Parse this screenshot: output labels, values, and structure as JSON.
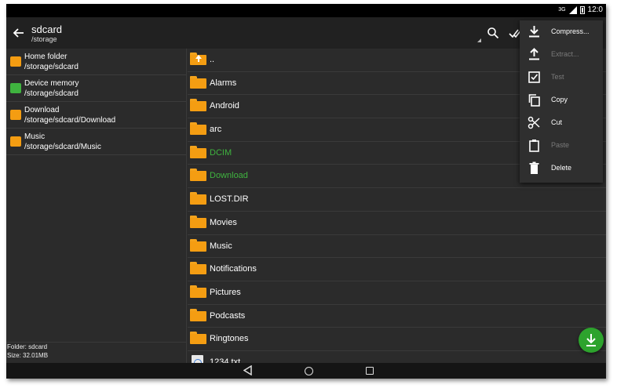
{
  "statusbar": {
    "signal": "3G",
    "time": "12:0"
  },
  "appbar": {
    "title": "sdcard",
    "subtitle": "/storage"
  },
  "bookmarks": [
    {
      "name": "Home folder",
      "path": "/storage/sdcard",
      "icon": "home-icon",
      "color": "#f49d12"
    },
    {
      "name": "Device memory",
      "path": "/storage/sdcard",
      "icon": "android-icon",
      "color": "#3fb33f"
    },
    {
      "name": "Download",
      "path": "/storage/sdcard/Download",
      "icon": "download-folder-icon",
      "color": "#f49d12"
    },
    {
      "name": "Music",
      "path": "/storage/sdcard/Music",
      "icon": "music-folder-icon",
      "color": "#f49d12"
    }
  ],
  "left_footer": {
    "folder": "Folder: sdcard",
    "size": "Size: 32.01MB"
  },
  "files": [
    {
      "name": "..",
      "type": "up"
    },
    {
      "name": "Alarms",
      "type": "folder"
    },
    {
      "name": "Android",
      "type": "folder"
    },
    {
      "name": "arc",
      "type": "folder"
    },
    {
      "name": "DCIM",
      "type": "folder",
      "highlight": true
    },
    {
      "name": "Download",
      "type": "folder",
      "highlight": true
    },
    {
      "name": "LOST.DIR",
      "type": "folder"
    },
    {
      "name": "Movies",
      "type": "folder"
    },
    {
      "name": "Music",
      "type": "folder"
    },
    {
      "name": "Notifications",
      "type": "folder"
    },
    {
      "name": "Pictures",
      "type": "folder"
    },
    {
      "name": "Podcasts",
      "type": "folder"
    },
    {
      "name": "Ringtones",
      "type": "folder"
    },
    {
      "name": "1234.txt",
      "type": "file"
    }
  ],
  "menu": {
    "items": [
      {
        "label": "Compress...",
        "icon": "download-tray-icon",
        "enabled": true
      },
      {
        "label": "Extract...",
        "icon": "upload-tray-icon",
        "enabled": false
      },
      {
        "label": "Test",
        "icon": "checkbox-icon",
        "enabled": false
      },
      {
        "label": "Copy",
        "icon": "copy-icon",
        "enabled": true
      },
      {
        "label": "Cut",
        "icon": "scissors-icon",
        "enabled": true
      },
      {
        "label": "Paste",
        "icon": "clipboard-icon",
        "enabled": false
      },
      {
        "label": "Delete",
        "icon": "trash-icon",
        "enabled": true
      }
    ]
  },
  "colors": {
    "accent_green": "#3fb33f",
    "folder_orange": "#f49d12",
    "fab_green": "#2da32d"
  }
}
